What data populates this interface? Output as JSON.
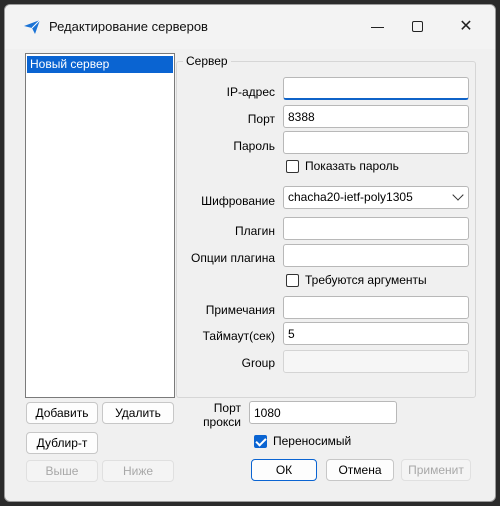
{
  "window": {
    "title": "Редактирование серверов",
    "icon": "paper-plane-icon",
    "accent_color": "#0a64d2"
  },
  "server_list": {
    "items": [
      {
        "label": "Новый сервер",
        "selected": true
      }
    ]
  },
  "server_group": {
    "title": "Сервер",
    "ip": {
      "label": "IP-адрес",
      "value": ""
    },
    "port": {
      "label": "Порт",
      "value": "8388"
    },
    "password": {
      "label": "Пароль",
      "value": ""
    },
    "show_password": {
      "label": "Показать пароль",
      "checked": false
    },
    "encryption": {
      "label": "Шифрование",
      "value": "chacha20-ietf-poly1305"
    },
    "plugin": {
      "label": "Плагин",
      "value": ""
    },
    "plugin_options": {
      "label": "Опции плагина",
      "value": ""
    },
    "need_args": {
      "label": "Требуются аргументы",
      "checked": false
    },
    "remarks": {
      "label": "Примечания",
      "value": ""
    },
    "timeout": {
      "label": "Таймаут(сек)",
      "value": "5"
    },
    "group": {
      "label": "Group",
      "value": ""
    }
  },
  "proxy": {
    "label_line1": "Порт",
    "label_line2": "прокси",
    "value": "1080",
    "portable": {
      "label": "Переносимый",
      "checked": true
    }
  },
  "buttons": {
    "add": "Добавить",
    "delete": "Удалить",
    "duplicate": "Дублир-т",
    "up": "Выше",
    "down": "Ниже",
    "ok": "ОК",
    "cancel": "Отмена",
    "apply": "Применит"
  }
}
